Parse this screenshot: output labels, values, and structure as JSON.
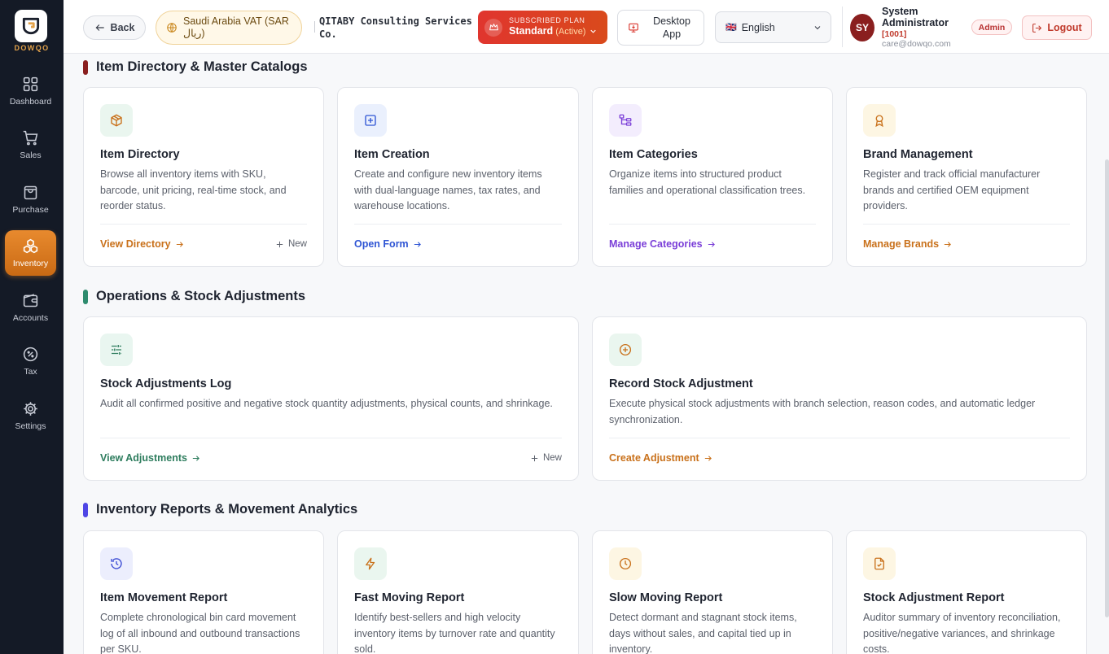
{
  "brand": {
    "logo_text": "DOWQO"
  },
  "sidebar": {
    "items": [
      {
        "label": "Dashboard"
      },
      {
        "label": "Sales"
      },
      {
        "label": "Purchase"
      },
      {
        "label": "Inventory"
      },
      {
        "label": "Accounts"
      },
      {
        "label": "Tax"
      },
      {
        "label": "Settings"
      }
    ]
  },
  "header": {
    "back_label": "Back",
    "vat_label": "Saudi Arabia VAT (SAR ريال)",
    "company_name": "QITABY Consulting Services Co.",
    "plan": {
      "caption": "SUBSCRIBED PLAN",
      "name": "Standard",
      "status": "(Active)"
    },
    "desktop_app_label": "Desktop App",
    "language": {
      "flag": "🇬🇧",
      "selected": "English"
    },
    "user": {
      "initials": "SY",
      "name": "System Administrator",
      "id": "[1001]",
      "email": "care@dowqo.com",
      "role": "Admin"
    },
    "logout_label": "Logout"
  },
  "sections": [
    {
      "title": "Item Directory & Master Catalogs",
      "accent": "#8a1f1f",
      "cards": [
        {
          "title": "Item Directory",
          "desc": "Browse all inventory items with SKU, barcode, unit pricing, real-time stock, and reorder status.",
          "link": "View Directory",
          "new": "New",
          "color": "#c9711b",
          "bg": "#eaf6ef",
          "icon": "box-icon"
        },
        {
          "title": "Item Creation",
          "desc": "Create and configure new inventory items with dual-language names, tax rates, and warehouse locations.",
          "link": "Open Form",
          "color": "#2f55d4",
          "bg": "#eaf0fd",
          "icon": "plus-square-icon"
        },
        {
          "title": "Item Categories",
          "desc": "Organize items into structured product families and operational classification trees.",
          "link": "Manage Categories",
          "color": "#7b3fd8",
          "bg": "#f3edfd",
          "icon": "tree-icon"
        },
        {
          "title": "Brand Management",
          "desc": "Register and track official manufacturer brands and certified OEM equipment providers.",
          "link": "Manage Brands",
          "color": "#c9711b",
          "bg": "#fdf6e3",
          "icon": "award-icon"
        }
      ]
    },
    {
      "title": "Operations & Stock Adjustments",
      "accent": "#2e8b6e",
      "cards": [
        {
          "title": "Stock Adjustments Log",
          "desc": "Audit all confirmed positive and negative stock quantity adjustments, physical counts, and shrinkage.",
          "link": "View Adjustments",
          "new": "New",
          "color": "#2e7d5e",
          "bg": "#e9f6f0",
          "icon": "sliders-icon"
        },
        {
          "title": "Record Stock Adjustment",
          "desc": "Execute physical stock adjustments with branch selection, reason codes, and automatic ledger synchronization.",
          "link": "Create Adjustment",
          "color": "#c9711b",
          "bg": "#eaf6ef",
          "icon": "plus-circle-icon"
        }
      ]
    },
    {
      "title": "Inventory Reports & Movement Analytics",
      "accent": "#4f46e5",
      "cards": [
        {
          "title": "Item Movement Report",
          "desc": "Complete chronological bin card movement log of all inbound and outbound transactions per SKU.",
          "color": "#3b4bd4",
          "bg": "#eceefd",
          "icon": "history-icon"
        },
        {
          "title": "Fast Moving Report",
          "desc": "Identify best-sellers and high velocity inventory items by turnover rate and quantity sold.",
          "color": "#c9711b",
          "bg": "#eaf6ef",
          "icon": "bolt-icon"
        },
        {
          "title": "Slow Moving Report",
          "desc": "Detect dormant and stagnant stock items, days without sales, and capital tied up in inventory.",
          "color": "#c9711b",
          "bg": "#fdf6e3",
          "icon": "clock-icon"
        },
        {
          "title": "Stock Adjustment Report",
          "desc": "Auditor summary of inventory reconciliation, positive/negative variances, and shrinkage costs.",
          "color": "#c9711b",
          "bg": "#fdf6e3",
          "icon": "file-check-icon"
        }
      ]
    }
  ]
}
